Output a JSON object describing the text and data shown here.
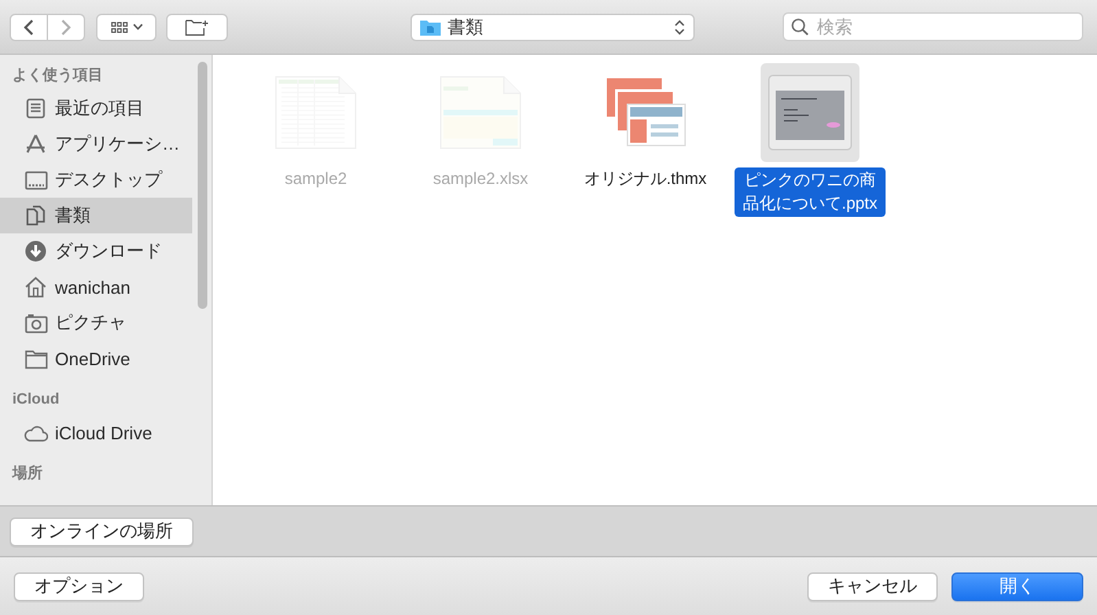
{
  "toolbar": {
    "path": {
      "label": "書類"
    },
    "search": {
      "placeholder": "検索"
    }
  },
  "sidebar": {
    "sections": [
      {
        "title": "よく使う項目",
        "items": [
          {
            "label": "最近の項目",
            "kind": "recent",
            "selected": false
          },
          {
            "label": "アプリケーシ…",
            "kind": "apps",
            "selected": false
          },
          {
            "label": "デスクトップ",
            "kind": "desktop",
            "selected": false
          },
          {
            "label": "書類",
            "kind": "documents",
            "selected": true
          },
          {
            "label": "ダウンロード",
            "kind": "downloads",
            "selected": false
          },
          {
            "label": "wanichan",
            "kind": "home",
            "selected": false
          },
          {
            "label": "ピクチャ",
            "kind": "pictures",
            "selected": false
          },
          {
            "label": "OneDrive",
            "kind": "folder",
            "selected": false
          }
        ]
      },
      {
        "title": "iCloud",
        "items": [
          {
            "label": "iCloud Drive",
            "kind": "cloud",
            "selected": false
          }
        ]
      },
      {
        "title": "場所"
      }
    ]
  },
  "files": [
    {
      "name": "sample2",
      "kind": "xls",
      "disabled": true,
      "selected": false
    },
    {
      "name": "sample2.xlsx",
      "kind": "xlsx",
      "disabled": true,
      "selected": false
    },
    {
      "name": "オリジナル.thmx",
      "kind": "thmx",
      "disabled": false,
      "selected": false
    },
    {
      "name": "ピンクのワニの商品化について.pptx",
      "kind": "pptx",
      "disabled": false,
      "selected": true
    }
  ],
  "online_button": "オンラインの場所",
  "footer": {
    "options": "オプション",
    "cancel": "キャンセル",
    "open": "開く"
  }
}
